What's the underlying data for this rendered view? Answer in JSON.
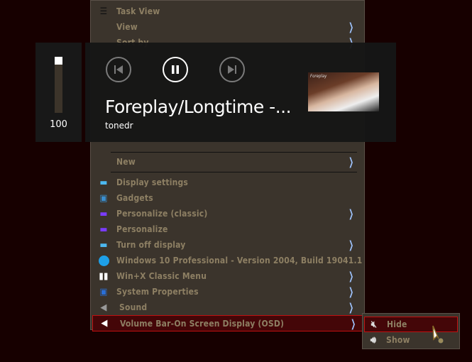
{
  "menu": {
    "items": [
      {
        "label": "Task View",
        "icon": "task-view-icon"
      },
      {
        "label": "View",
        "submenu": true
      },
      {
        "label": "Sort by",
        "submenu": true
      },
      {
        "label": "New",
        "submenu": true
      },
      {
        "label": "Display settings",
        "icon": "monitor-icon"
      },
      {
        "label": "Gadgets",
        "icon": "gadgets-icon"
      },
      {
        "label": "Personalize (classic)",
        "icon": "personalize-icon",
        "submenu": true
      },
      {
        "label": "Personalize",
        "icon": "personalize-icon"
      },
      {
        "label": "Turn off display",
        "icon": "monitor-icon",
        "submenu": true
      },
      {
        "label": "Windows 10 Professional - Version 2004, Build 19041.1",
        "icon": "windows-logo-icon"
      },
      {
        "label": "Win+X Classic Menu",
        "icon": "windows-flag-icon",
        "submenu": true
      },
      {
        "label": "System Properties",
        "icon": "system-properties-icon",
        "submenu": true
      },
      {
        "label": "Sound",
        "icon": "speaker-icon",
        "submenu": true
      },
      {
        "label": "Volume Bar-On Screen Display (OSD)",
        "icon": "speaker-icon",
        "submenu": true,
        "selected": true
      }
    ]
  },
  "submenu": {
    "items": [
      {
        "label": "Hide",
        "icon": "mute-icon",
        "selected": true
      },
      {
        "label": "Show",
        "icon": "volume-icon"
      }
    ]
  },
  "osd": {
    "volume": 100,
    "volume_label": "100",
    "title": "Foreplay/Longtime -...",
    "artist": "tonedr",
    "thumbnail_text": "Foreplay"
  },
  "colors": {
    "menu_bg": "#3b342c",
    "menu_text": "#8d7f63",
    "selected_bg": "#440608",
    "selected_border": "#c01010",
    "arrow": "#9fc4ff"
  }
}
